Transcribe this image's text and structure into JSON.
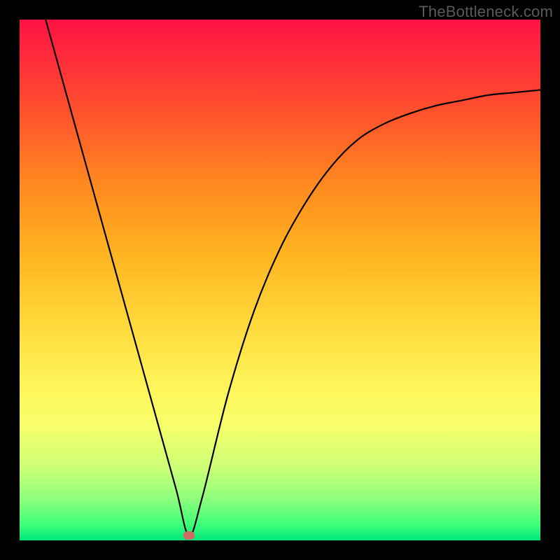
{
  "watermark": "TheBottleneck.com",
  "colors": {
    "frame": "#000000",
    "curve_stroke": "#000000",
    "dot_fill": "#cf6b63"
  },
  "chart_data": {
    "type": "line",
    "title": "",
    "xlabel": "",
    "ylabel": "",
    "xlim": [
      0,
      100
    ],
    "ylim": [
      0,
      100
    ],
    "grid": false,
    "legend": false,
    "notes": "V-shaped bottleneck curve. Vertical axis inverted visually (0 at bottom = green/good, 100 at top = red/bad). The curve dips to near-zero at the optimum point then rises asymptotically toward the right.",
    "series": [
      {
        "name": "bottleneck",
        "x": [
          5,
          10,
          15,
          20,
          25,
          30,
          32.5,
          35,
          40,
          45,
          50,
          55,
          60,
          65,
          70,
          75,
          80,
          85,
          90,
          95,
          100
        ],
        "values": [
          100,
          82,
          64,
          46,
          28,
          10,
          1,
          8,
          28,
          44,
          56,
          65,
          72,
          77,
          80,
          82,
          83.5,
          84.5,
          85.5,
          86,
          86.5
        ]
      }
    ],
    "optimum_point": {
      "x": 32.5,
      "y": 1
    }
  }
}
